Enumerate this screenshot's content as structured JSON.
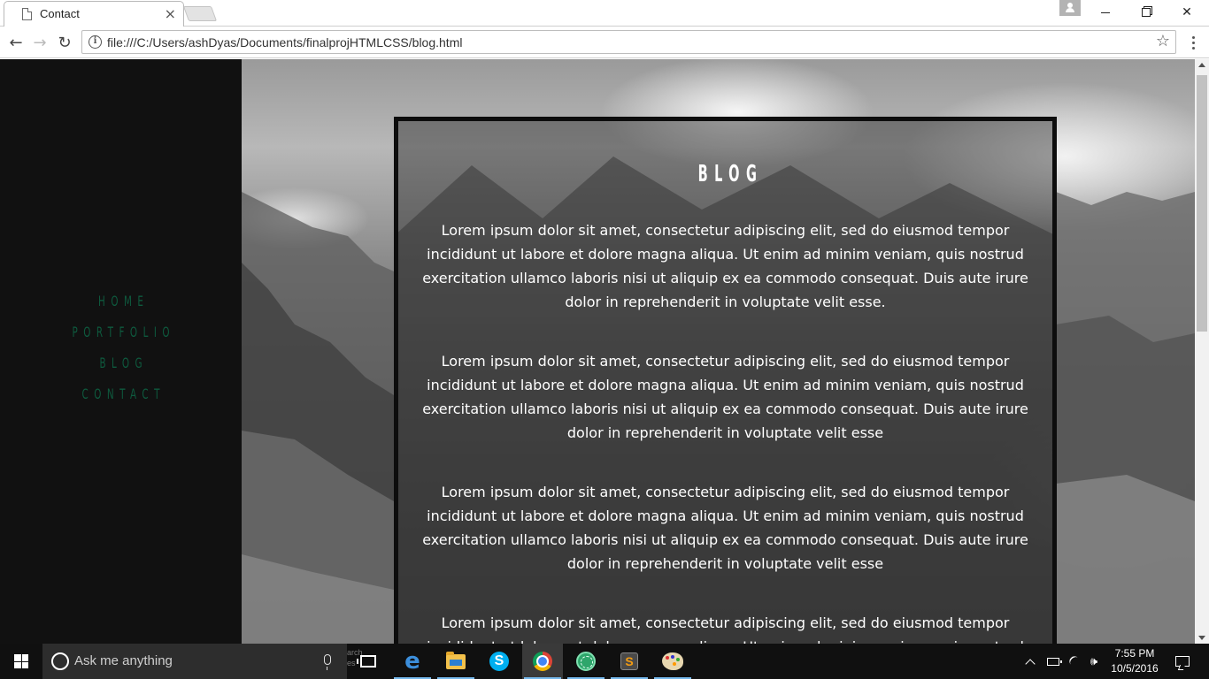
{
  "browser": {
    "tab_title": "Contact",
    "tab_close": "×",
    "url": "file:///C:/Users/ashDyas/Documents/finalprojHTMLCSS/blog.html",
    "back": "←",
    "forward": "→",
    "reload": "↻",
    "star": "☆",
    "close_window": "✕"
  },
  "page": {
    "nav": [
      "HOME",
      "PORTFOLIO",
      "BLOG",
      "CONTACT"
    ],
    "nav_color": "#0e5a3e",
    "title": "BLOG",
    "paragraphs": [
      "Lorem ipsum dolor sit amet, consectetur adipiscing elit, sed do eiusmod tempor incididunt ut labore et dolore magna aliqua. Ut enim ad minim veniam, quis nostrud exercitation ullamco laboris nisi ut aliquip ex ea commodo consequat. Duis aute irure dolor in reprehenderit in voluptate velit esse.",
      "Lorem ipsum dolor sit amet, consectetur adipiscing elit, sed do eiusmod tempor incididunt ut labore et dolore magna aliqua. Ut enim ad minim veniam, quis nostrud exercitation ullamco laboris nisi ut aliquip ex ea commodo consequat. Duis aute irure dolor in reprehenderit in voluptate velit esse",
      "Lorem ipsum dolor sit amet, consectetur adipiscing elit, sed do eiusmod tempor incididunt ut labore et dolore magna aliqua. Ut enim ad minim veniam, quis nostrud exercitation ullamco laboris nisi ut aliquip ex ea commodo consequat. Duis aute irure dolor in reprehenderit in voluptate velit esse",
      "Lorem ipsum dolor sit amet, consectetur adipiscing elit, sed do eiusmod tempor incididunt ut labore et dolore magna aliqua. Ut enim ad minim veniam, quis nostrud"
    ]
  },
  "taskbar": {
    "search_placeholder": "Ask me anything",
    "ghost_text": "arch es",
    "time": "7:55 PM",
    "date": "10/5/2016",
    "icons": [
      "task-view-icon",
      "edge-icon",
      "file-explorer-icon",
      "skype-icon",
      "chrome-icon",
      "globe-app-icon",
      "sublime-text-icon",
      "paint-icon"
    ],
    "accent": "#76b9ed"
  }
}
